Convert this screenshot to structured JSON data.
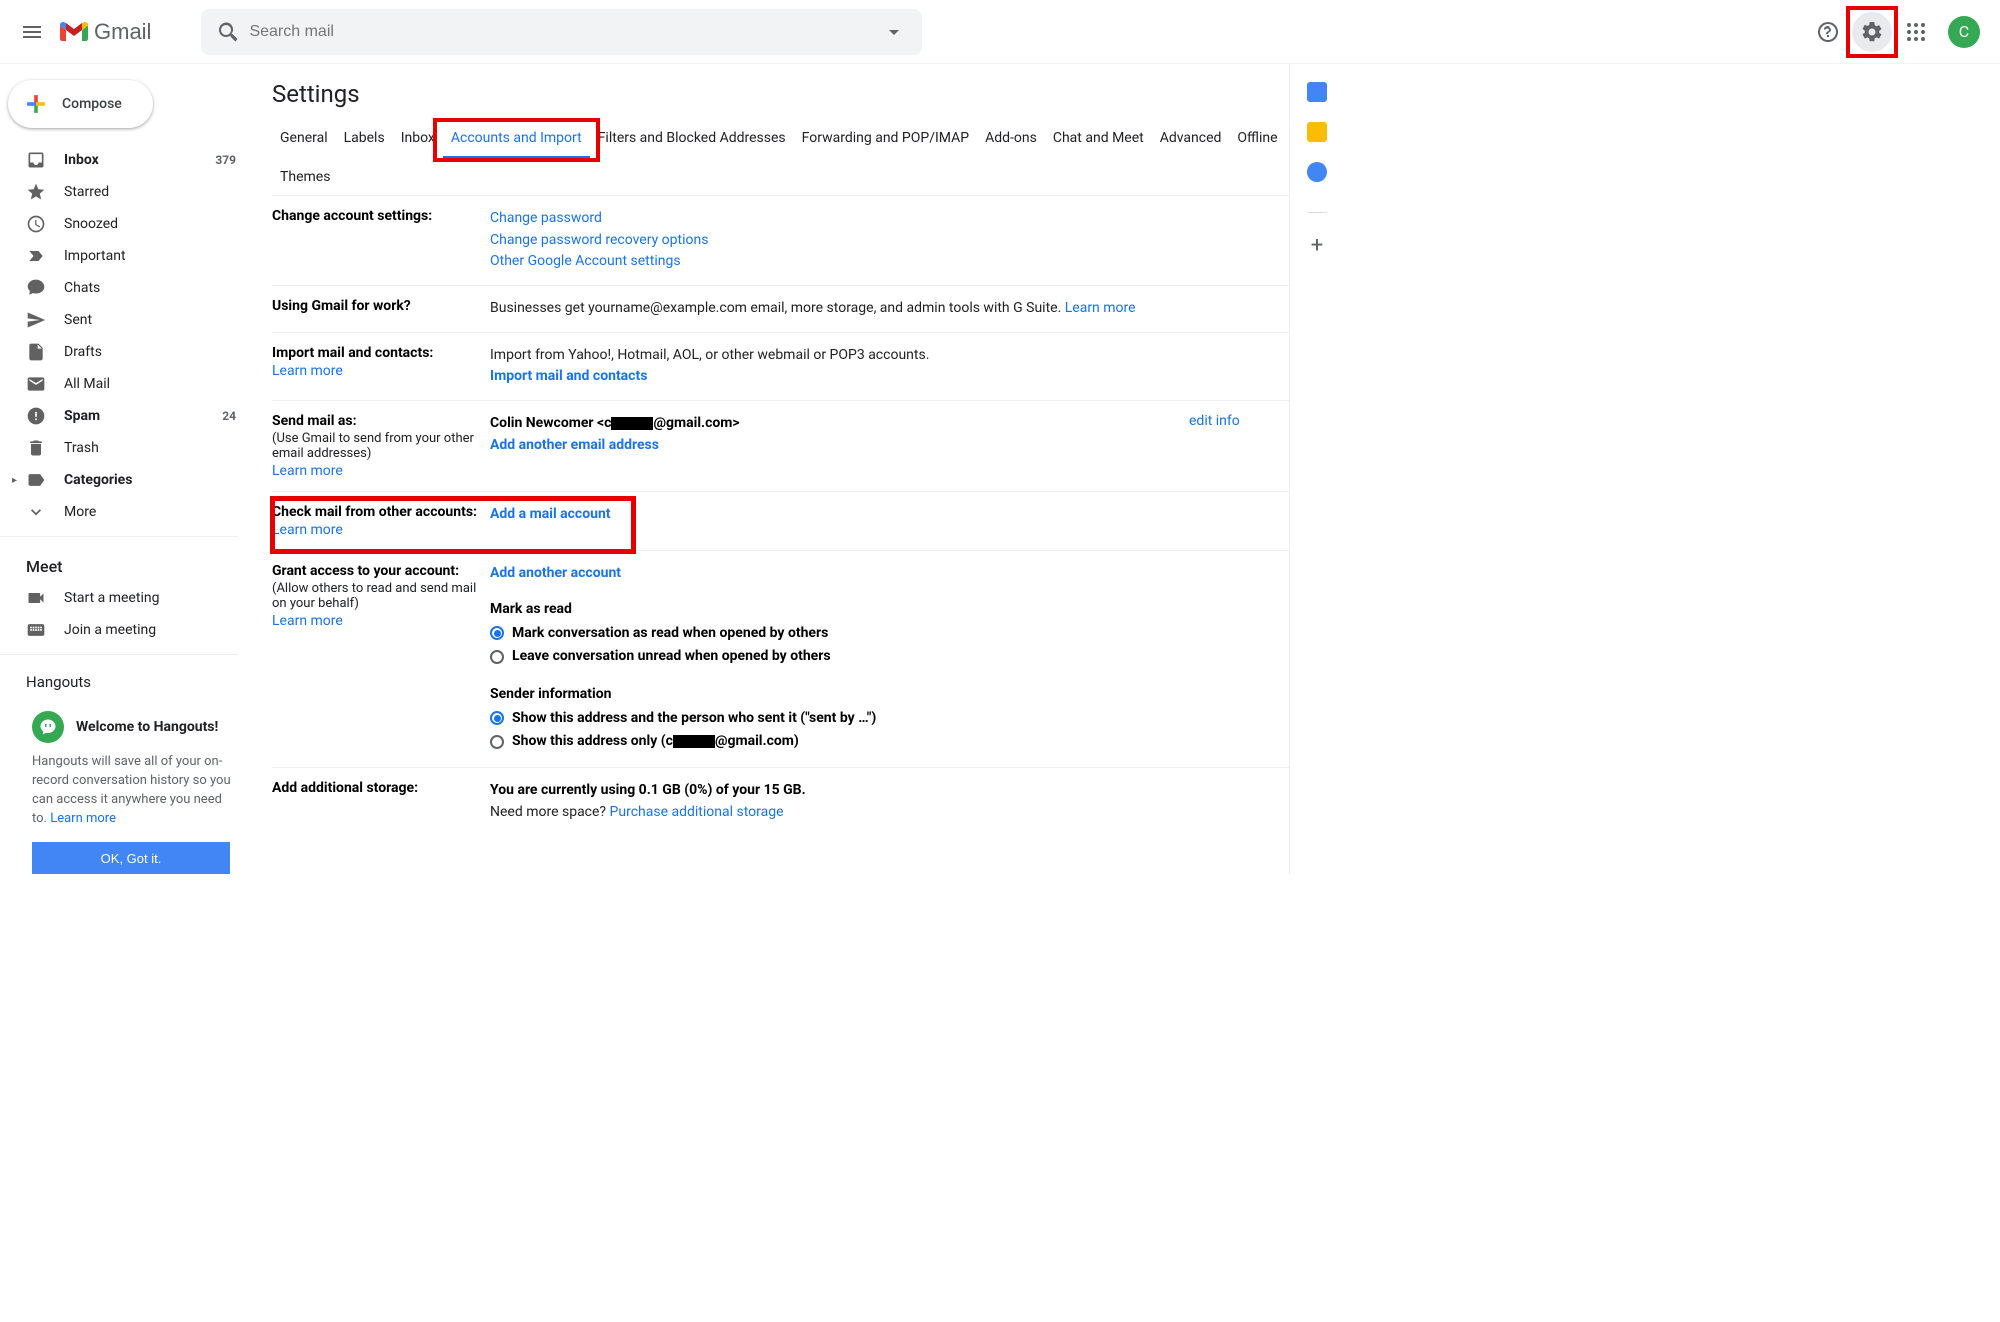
{
  "header": {
    "brand": "Gmail",
    "search_placeholder": "Search mail",
    "avatar_initial": "C"
  },
  "compose": {
    "label": "Compose"
  },
  "sidebar": {
    "items": [
      {
        "label": "Inbox",
        "count": "379",
        "bold": true,
        "icon": "inbox"
      },
      {
        "label": "Starred",
        "icon": "star"
      },
      {
        "label": "Snoozed",
        "icon": "clock"
      },
      {
        "label": "Important",
        "icon": "important"
      },
      {
        "label": "Chats",
        "icon": "chat"
      },
      {
        "label": "Sent",
        "icon": "send"
      },
      {
        "label": "Drafts",
        "icon": "draft"
      },
      {
        "label": "All Mail",
        "icon": "allmail"
      },
      {
        "label": "Spam",
        "count": "24",
        "bold": true,
        "icon": "spam"
      },
      {
        "label": "Trash",
        "icon": "trash"
      },
      {
        "label": "Categories",
        "bold": true,
        "icon": "label",
        "chev": true
      },
      {
        "label": "More",
        "icon": "expand"
      }
    ]
  },
  "meet": {
    "title": "Meet",
    "start": "Start a meeting",
    "join": "Join a meeting"
  },
  "hangouts": {
    "title": "Hangouts",
    "card_title": "Welcome to Hangouts!",
    "card_body": "Hangouts will save all of your on-record conversation history so you can access it anywhere you need to. ",
    "learn": "Learn more",
    "ok": "OK, Got it."
  },
  "settings": {
    "title": "Settings",
    "tabs": [
      "General",
      "Labels",
      "Inbox",
      "Accounts and Import",
      "Filters and Blocked Addresses",
      "Forwarding and POP/IMAP",
      "Add-ons",
      "Chat and Meet",
      "Advanced",
      "Offline",
      "Themes"
    ],
    "active_tab": "Accounts and Import"
  },
  "rows": {
    "change": {
      "label": "Change account settings:",
      "l1": "Change password",
      "l2": "Change password recovery options",
      "l3": "Other Google Account settings"
    },
    "work": {
      "label": "Using Gmail for work?",
      "body": "Businesses get yourname@example.com email, more storage, and admin tools with G Suite. ",
      "learn": "Learn more"
    },
    "import": {
      "label": "Import mail and contacts:",
      "learn": "Learn more",
      "body": "Import from Yahoo!, Hotmail, AOL, or other webmail or POP3 accounts.",
      "action": "Import mail and contacts"
    },
    "sendas": {
      "label": "Send mail as:",
      "sub": "(Use Gmail to send from your other email addresses)",
      "learn": "Learn more",
      "name": "Colin Newcomer <c",
      "email_suffix": "@gmail.com>",
      "action": "Add another email address",
      "edit": "edit info"
    },
    "checkmail": {
      "label": "Check mail from other accounts:",
      "learn": "Learn more",
      "action": "Add a mail account"
    },
    "grant": {
      "label": "Grant access to your account:",
      "sub": "(Allow others to read and send mail on your behalf)",
      "learn": "Learn more",
      "action": "Add another account",
      "mark_title": "Mark as read",
      "mark_o1": "Mark conversation as read when opened by others",
      "mark_o2": "Leave conversation unread when opened by others",
      "sender_title": "Sender information",
      "sender_o1": "Show this address and the person who sent it (\"sent by …\")",
      "sender_o2a": "Show this address only (c",
      "sender_o2b": "@gmail.com)"
    },
    "storage": {
      "label": "Add additional storage:",
      "body": "You are currently using 0.1 GB (0%) of your 15 GB.",
      "more": "Need more space? ",
      "link": "Purchase additional storage"
    }
  }
}
